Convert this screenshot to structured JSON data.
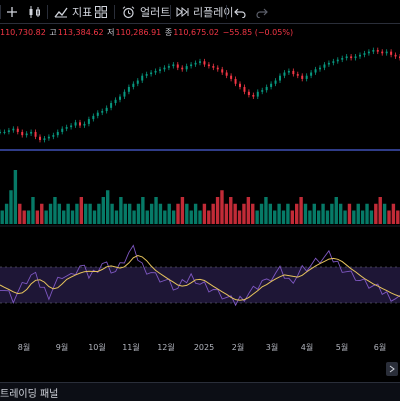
{
  "toolbar": {
    "indicators_label": "지표",
    "alert_label": "얼러트",
    "replay_label": "리플레이"
  },
  "ohlc": {
    "open_value": "110,730.82",
    "high_key": "고",
    "high_value": "113,384.62",
    "low_key": "저",
    "low_value": "110,286.91",
    "close_key": "종",
    "close_value": "110,675.02",
    "change": "−55.85 (−0.05%)"
  },
  "chart_data": {
    "type": "line",
    "x_ticks": [
      "8월",
      "9월",
      "10월",
      "11월",
      "12월",
      "2025",
      "2월",
      "3월",
      "4월",
      "5월",
      "6월"
    ],
    "price_series": [
      60,
      60,
      61,
      62,
      60,
      58,
      59,
      60,
      57,
      55,
      56,
      57,
      58,
      60,
      62,
      63,
      64,
      66,
      64,
      65,
      68,
      70,
      72,
      73,
      75,
      78,
      80,
      82,
      85,
      88,
      90,
      92,
      95,
      96,
      97,
      98,
      99,
      100,
      101,
      102,
      100,
      99,
      101,
      102,
      103,
      104,
      102,
      101,
      100,
      99,
      97,
      95,
      93,
      90,
      88,
      85,
      83,
      82,
      85,
      86,
      88,
      90,
      92,
      95,
      97,
      98,
      96,
      95,
      93,
      95,
      97,
      99,
      100,
      102,
      103,
      104,
      105,
      106,
      107,
      106,
      107,
      108,
      109,
      110,
      111,
      110,
      109,
      110,
      108,
      107,
      106
    ],
    "volume_series": [
      2,
      3,
      5,
      8,
      3,
      2,
      2,
      4,
      2,
      3,
      2,
      3,
      4,
      3,
      2,
      3,
      2,
      3,
      4,
      3,
      3,
      2,
      3,
      4,
      5,
      3,
      2,
      4,
      3,
      3,
      2,
      3,
      4,
      2,
      3,
      4,
      3,
      2,
      3,
      2,
      3,
      4,
      3,
      2,
      3,
      2,
      3,
      2,
      3,
      4,
      5,
      3,
      4,
      3,
      2,
      3,
      4,
      3,
      2,
      3,
      4,
      3,
      2,
      3,
      2,
      3,
      2,
      3,
      4,
      3,
      2,
      3,
      2,
      3,
      2,
      3,
      4,
      3,
      2,
      3,
      2,
      3,
      2,
      3,
      2,
      3,
      4,
      3,
      2,
      3,
      2
    ],
    "osc_series": [
      50,
      45,
      40,
      35,
      42,
      48,
      55,
      60,
      58,
      50,
      45,
      40,
      48,
      55,
      62,
      60,
      58,
      65,
      70,
      66,
      60,
      64,
      70,
      75,
      72,
      68,
      65,
      70,
      78,
      85,
      88,
      80,
      72,
      68,
      65,
      60,
      58,
      55,
      52,
      48,
      45,
      50,
      55,
      60,
      58,
      52,
      50,
      47,
      45,
      40,
      38,
      35,
      32,
      30,
      35,
      38,
      42,
      45,
      50,
      55,
      52,
      58,
      62,
      65,
      60,
      55,
      58,
      62,
      68,
      70,
      72,
      75,
      78,
      80,
      82,
      78,
      74,
      70,
      66,
      62,
      60,
      55,
      52,
      50,
      48,
      45,
      42,
      40,
      38,
      36,
      35
    ],
    "osc_bands": [
      70,
      30
    ]
  },
  "panel": {
    "tab_label": "트레이딩 패널"
  },
  "colors": {
    "price_line": "#089981",
    "up": "#089981",
    "down": "#f23645",
    "hline": "#3f51b5",
    "osc_fill": "#1e1636",
    "osc_line": "#7e57c2",
    "osc_signal": "#e6c35c"
  }
}
